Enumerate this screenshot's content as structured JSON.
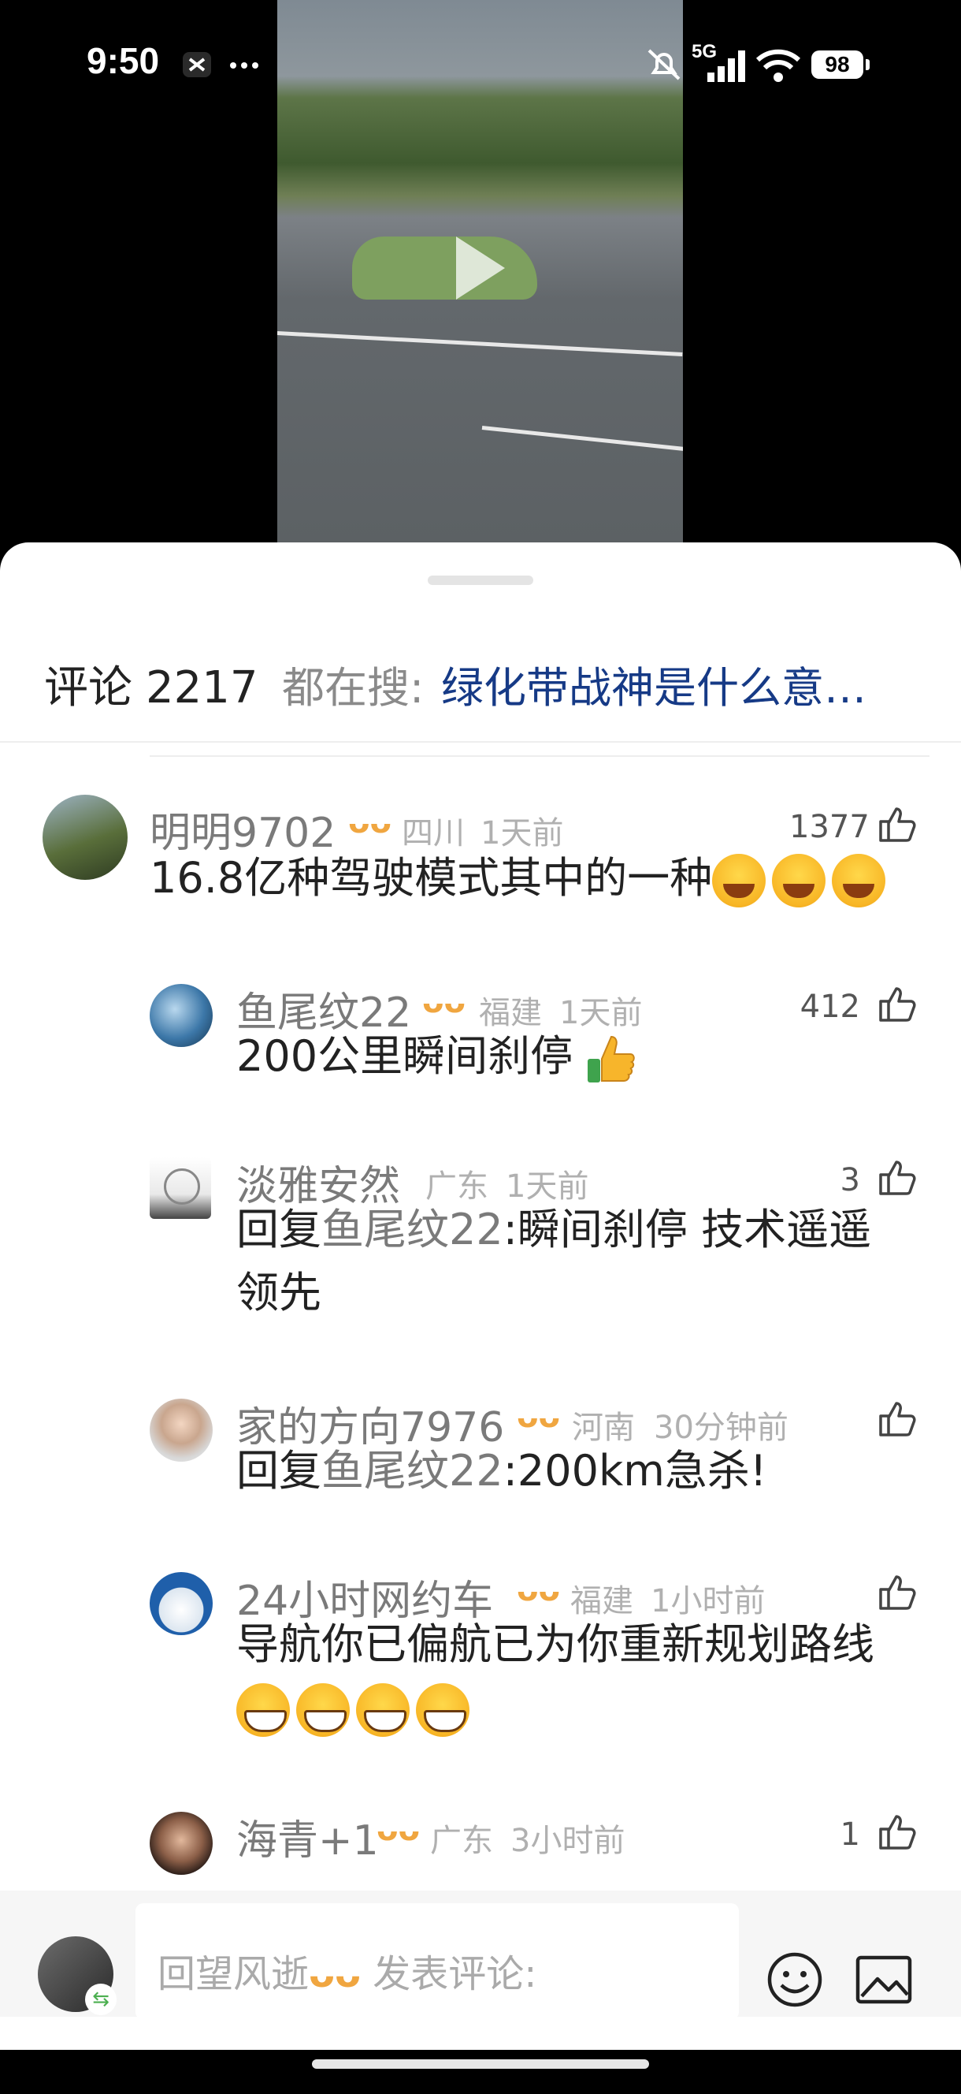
{
  "status_bar": {
    "time": "9:50",
    "network": "5G",
    "battery": "98"
  },
  "header": {
    "title": "评论",
    "count": "2217",
    "search_label": "都在搜:",
    "search_term": "绿化带战神是什么意…"
  },
  "comments": [
    {
      "name": "明明9702",
      "location": "四川",
      "time": "1天前",
      "likes": "1377",
      "text": "16.8亿种驾驶模式其中的一种",
      "emojis": [
        "cry-laugh-icon",
        "cry-laugh-icon",
        "cry-laugh-icon"
      ]
    },
    {
      "name": "鱼尾纹22",
      "location": "福建",
      "time": "1天前",
      "likes": "412",
      "text": "200公里瞬间刹停",
      "emojis": [
        "thumbs-up-icon"
      ]
    },
    {
      "name": "淡雅安然",
      "location": "广东",
      "time": "1天前",
      "likes": "3",
      "reply_prefix": "回复",
      "reply_to": "鱼尾纹22",
      "text_line1": ":瞬间刹停 技术遥遥",
      "text_line2": "领先"
    },
    {
      "name": "家的方向7976",
      "location": "河南",
      "time": "30分钟前",
      "likes": "",
      "reply_prefix": "回复",
      "reply_to": "鱼尾纹22",
      "text": ":200km急杀!"
    },
    {
      "name": "24小时网约车",
      "location": "福建",
      "time": "1小时前",
      "likes": "",
      "text": "导航你已偏航已为你重新规划路线",
      "emojis": [
        "grin-icon",
        "grin-icon",
        "grin-icon",
        "grin-icon"
      ]
    },
    {
      "name": "海青+1",
      "location": "广东",
      "time": "3小时前",
      "likes": "1"
    }
  ],
  "bottom_bar": {
    "user_name": "回望风逝",
    "placeholder": "发表评论:"
  },
  "colors": {
    "search_term": "#163a86",
    "badge": "#f0a640",
    "meta": "#b0b0b0"
  }
}
